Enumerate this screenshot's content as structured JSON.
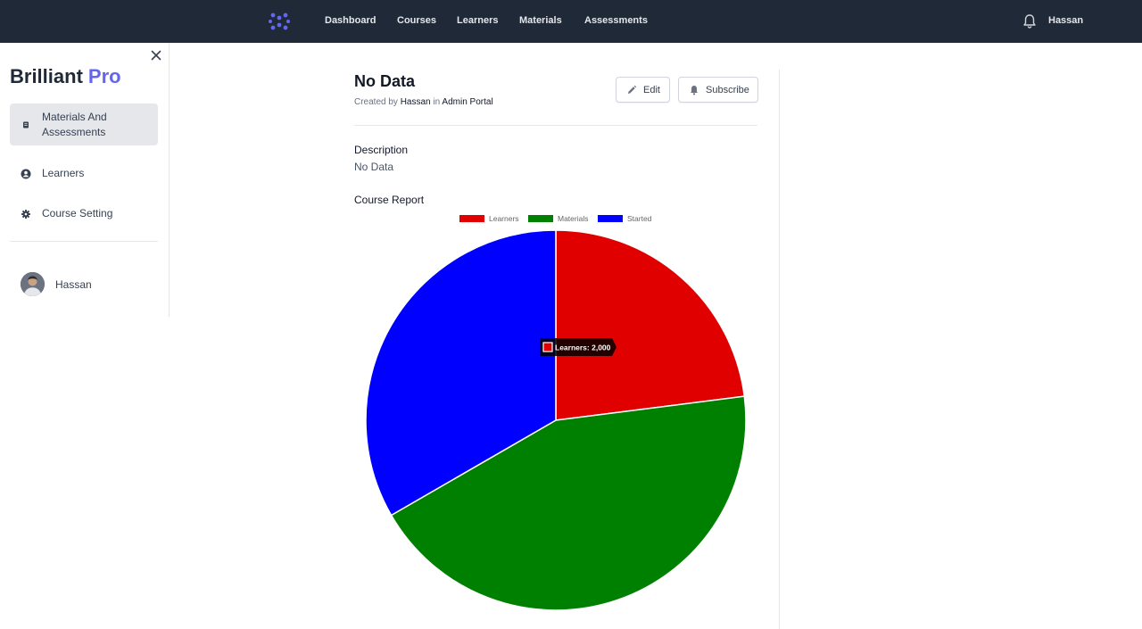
{
  "topbar": {
    "nav": [
      {
        "id": "dashboard",
        "label": "Dashboard"
      },
      {
        "id": "courses",
        "label": "Courses"
      },
      {
        "id": "learners",
        "label": "Learners"
      },
      {
        "id": "materials",
        "label": "Materials"
      },
      {
        "id": "assessments",
        "label": "Assessments"
      }
    ],
    "user_name": "Hassan",
    "logo_icon": "hub-dots-icon",
    "bell_icon": "bell-icon"
  },
  "sidebar": {
    "brand": {
      "primary": "Brilliant",
      "accent": "Pro"
    },
    "items": [
      {
        "label": "Materials And Assessments",
        "icon": "document-icon",
        "active": true
      },
      {
        "label": "Learners",
        "icon": "user-circle-icon",
        "active": false
      },
      {
        "label": "Course Setting",
        "icon": "gear-icon",
        "active": false
      }
    ],
    "user_name": "Hassan"
  },
  "main": {
    "title": "No Data",
    "meta": {
      "prefix": "Created by",
      "author": "Hassan",
      "joiner": "in",
      "portal": "Admin Portal"
    },
    "buttons": {
      "edit": "Edit",
      "subscribe": "Subscribe"
    },
    "description_label": "Description",
    "description_value": "No Data",
    "report_label": "Course Report"
  },
  "colors": {
    "accent": "#6366f1",
    "topbar": "#1f2937"
  },
  "chart_data": {
    "type": "pie",
    "categories": [
      "Learners",
      "Materials",
      "Started"
    ],
    "values": [
      2000,
      3800,
      2900
    ],
    "colors": [
      "#e00000",
      "#008000",
      "#0000ff"
    ],
    "legend": "top",
    "tooltip": {
      "label": "Learners: 2,000",
      "color": "#e00000"
    }
  }
}
